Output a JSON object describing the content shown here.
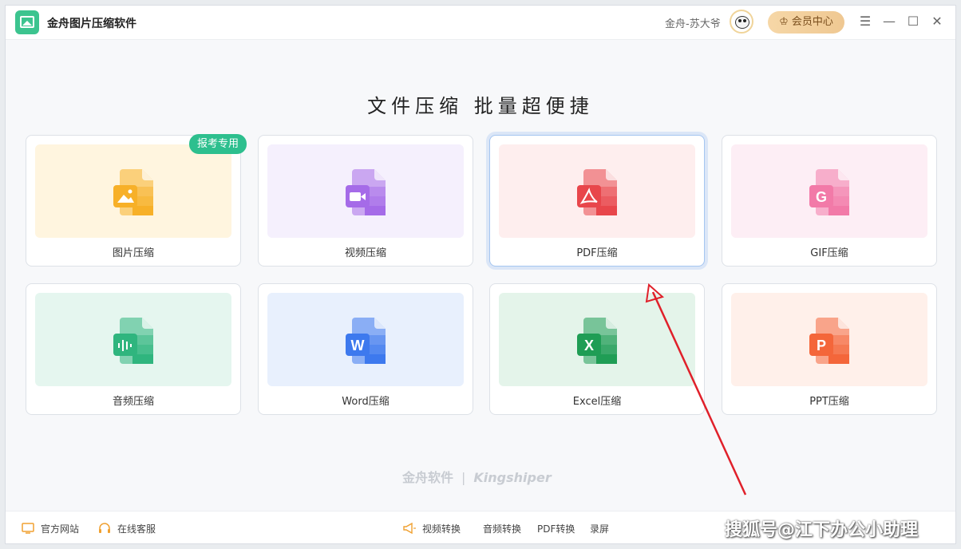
{
  "app": {
    "title": "金舟图片压缩软件"
  },
  "user": {
    "name": "金舟-苏大爷"
  },
  "header": {
    "vip_label": "会员中心"
  },
  "main": {
    "headline": "文件压缩  批量超便捷",
    "badge": "报考专用",
    "cards": [
      {
        "label": "图片压缩",
        "icon": "image-file-icon",
        "glyph": "",
        "color": "#f7b028",
        "bg": "#fff5df"
      },
      {
        "label": "视频压缩",
        "icon": "video-file-icon",
        "glyph": "",
        "color": "#a56be8",
        "bg": "#f5f0fd"
      },
      {
        "label": "PDF压缩",
        "icon": "pdf-file-icon",
        "glyph": "",
        "color": "#e8464b",
        "bg": "#feeeee"
      },
      {
        "label": "GIF压缩",
        "icon": "gif-file-icon",
        "glyph": "G",
        "color": "#f27aa8",
        "bg": "#fdeef5"
      },
      {
        "label": "音频压缩",
        "icon": "audio-file-icon",
        "glyph": "",
        "color": "#2fb57e",
        "bg": "#e5f6ef"
      },
      {
        "label": "Word压缩",
        "icon": "word-file-icon",
        "glyph": "W",
        "color": "#3d79ee",
        "bg": "#e8f0fd"
      },
      {
        "label": "Excel压缩",
        "icon": "excel-file-icon",
        "glyph": "X",
        "color": "#1f9d55",
        "bg": "#e4f4ea"
      },
      {
        "label": "PPT压缩",
        "icon": "ppt-file-icon",
        "glyph": "P",
        "color": "#f4663a",
        "bg": "#fff0ea"
      }
    ]
  },
  "watermark": {
    "brand": "金舟软件",
    "brand_en": "Kingshiper"
  },
  "footer": {
    "official_site": "官方网站",
    "online_service": "在线客服",
    "video_convert": "视频转换",
    "audio_convert": "音频转换",
    "pdf_convert": "PDF转换",
    "screen_record": "录屏"
  },
  "overlay": {
    "text": "搜狐号@江下办公小助理"
  },
  "colors": {
    "accent_green": "#2dbf8e",
    "vip_gold": "#efc892",
    "arrow_red": "#e0202a"
  }
}
